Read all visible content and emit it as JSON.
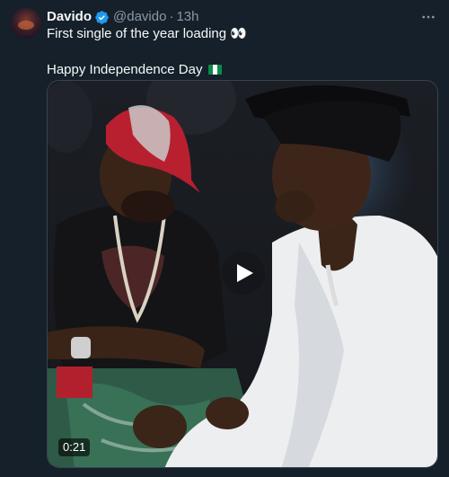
{
  "tweet": {
    "display_name": "Davido",
    "handle": "@davido",
    "separator": "·",
    "time": "13h",
    "text_line1": "First single of the year loading 👀",
    "text_line2": "Happy Independence Day"
  },
  "media": {
    "duration": "0:21"
  },
  "colors": {
    "background": "#15202b",
    "verified_blue": "#1d9bf0",
    "secondary_text": "#8b98a5"
  },
  "icons": {
    "verified": "verified-badge-icon",
    "more": "more-horizontal-icon",
    "play": "play-icon",
    "flag": "nigeria-flag-icon"
  }
}
